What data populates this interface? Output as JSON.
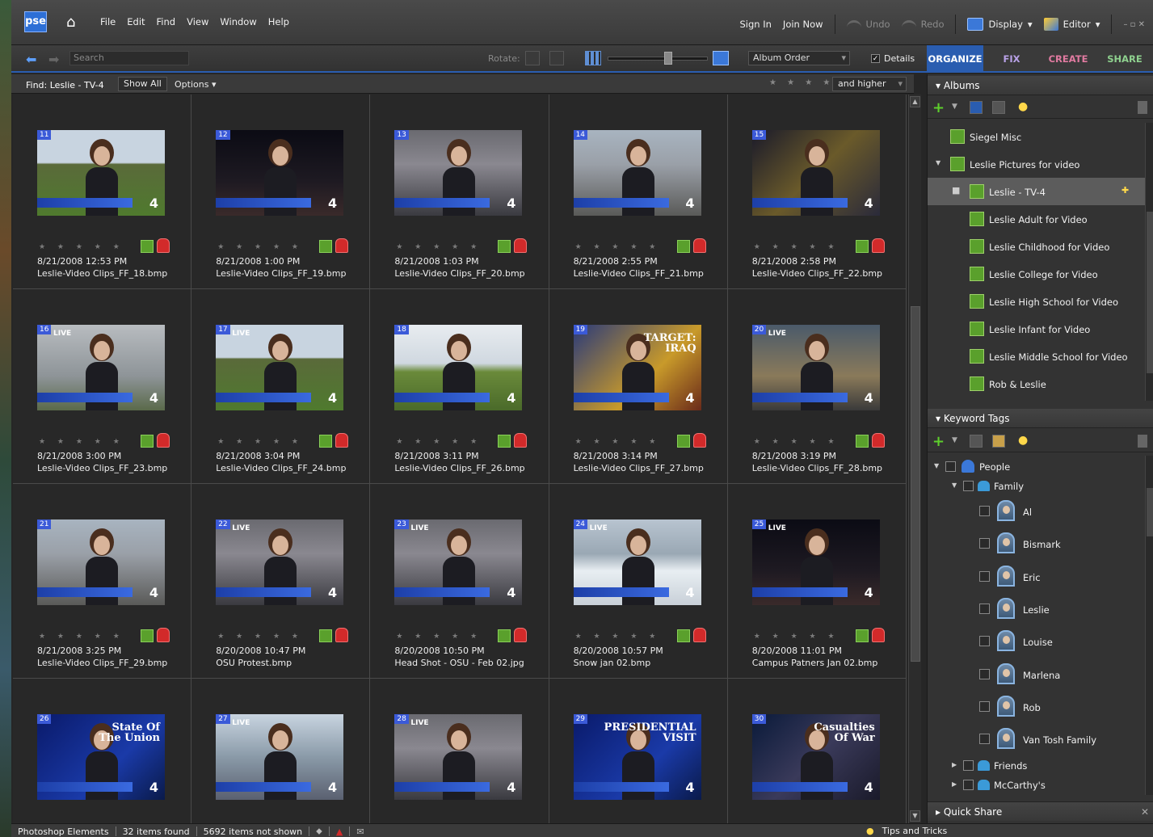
{
  "app": {
    "logo": "pse"
  },
  "menu": [
    "File",
    "Edit",
    "Find",
    "View",
    "Window",
    "Help"
  ],
  "menubar_right": {
    "sign_in": "Sign In",
    "join_now": "Join Now",
    "undo": "Undo",
    "redo": "Redo",
    "display": "Display",
    "editor": "Editor"
  },
  "toolbar": {
    "search_placeholder": "Search",
    "rotate_label": "Rotate:",
    "sort": "Album Order",
    "details_label": "Details",
    "details_checked": true
  },
  "tabs": [
    "ORGANIZE",
    "FIX",
    "CREATE",
    "SHARE"
  ],
  "findbar": {
    "find_label": "Find: Leslie - TV-4",
    "show_all": "Show All",
    "options": "Options",
    "rating_stars": "★ ★ ★ ★ ★",
    "rating_filter": "and higher"
  },
  "items": [
    {
      "num": "11",
      "date": "8/21/2008 12:53 PM",
      "name": "Leslie-Video Clips_FF_18.bmp",
      "scene": "outdoor",
      "live": ""
    },
    {
      "num": "12",
      "date": "8/21/2008 1:00 PM",
      "name": "Leslie-Video Clips_FF_19.bmp",
      "scene": "night",
      "live": ""
    },
    {
      "num": "13",
      "date": "8/21/2008 1:03 PM",
      "name": "Leslie-Video Clips_FF_20.bmp",
      "scene": "building",
      "live": ""
    },
    {
      "num": "14",
      "date": "8/21/2008 2:55 PM",
      "name": "Leslie-Video Clips_FF_21.bmp",
      "scene": "street",
      "live": ""
    },
    {
      "num": "15",
      "date": "8/21/2008 2:58 PM",
      "name": "Leslie-Video Clips_FF_22.bmp",
      "scene": "studio",
      "live": ""
    },
    {
      "num": "16",
      "date": "8/21/2008 3:00 PM",
      "name": "Leslie-Video Clips_FF_23.bmp",
      "scene": "fog",
      "live": "LIVE"
    },
    {
      "num": "17",
      "date": "8/21/2008 3:04 PM",
      "name": "Leslie-Video Clips_FF_24.bmp",
      "scene": "outdoor",
      "live": "LIVE"
    },
    {
      "num": "18",
      "date": "8/21/2008 3:11 PM",
      "name": "Leslie-Video Clips_FF_26.bmp",
      "scene": "sign",
      "live": ""
    },
    {
      "num": "19",
      "date": "8/21/2008 3:14 PM",
      "name": "Leslie-Video Clips_FF_27.bmp",
      "scene": "iraq",
      "live": "",
      "headline": "TARGET:\nIRAQ"
    },
    {
      "num": "20",
      "date": "8/21/2008 3:19 PM",
      "name": "Leslie-Video Clips_FF_28.bmp",
      "scene": "newsroom",
      "live": "LIVE"
    },
    {
      "num": "21",
      "date": "8/21/2008 3:25 PM",
      "name": "Leslie-Video Clips_FF_29.bmp",
      "scene": "street",
      "live": ""
    },
    {
      "num": "22",
      "date": "8/20/2008 10:47 PM",
      "name": "OSU Protest.bmp",
      "scene": "building",
      "live": "LIVE"
    },
    {
      "num": "23",
      "date": "8/20/2008 10:50 PM",
      "name": "Head Shot - OSU - Feb 02.jpg",
      "scene": "building",
      "live": "LIVE"
    },
    {
      "num": "24",
      "date": "8/20/2008 10:57 PM",
      "name": "Snow jan 02.bmp",
      "scene": "snow",
      "live": "LIVE"
    },
    {
      "num": "25",
      "date": "8/20/2008 11:01 PM",
      "name": "Campus Patners Jan 02.bmp",
      "scene": "night",
      "live": "LIVE"
    },
    {
      "num": "26",
      "date": "",
      "name": "",
      "scene": "stateunion",
      "live": "",
      "headline": "State Of\nThe Union"
    },
    {
      "num": "27",
      "date": "",
      "name": "",
      "scene": "umbrella",
      "live": "LIVE"
    },
    {
      "num": "28",
      "date": "",
      "name": "",
      "scene": "building",
      "live": "LIVE"
    },
    {
      "num": "29",
      "date": "",
      "name": "",
      "scene": "stateunion",
      "live": "",
      "headline": "PRESIDENTIAL\nVISIT"
    },
    {
      "num": "30",
      "date": "",
      "name": "",
      "scene": "war",
      "live": "",
      "headline": "Casualties\nOf War"
    }
  ],
  "albums": {
    "title": "Albums",
    "rows": [
      {
        "label": "Siegel Misc",
        "indent": 0,
        "expand": false,
        "selected": false
      },
      {
        "label": "Leslie Pictures for video",
        "indent": 0,
        "expand": true,
        "selected": false
      },
      {
        "label": "Leslie - TV-4",
        "indent": 1,
        "expand": false,
        "selected": true
      },
      {
        "label": "Leslie Adult for Video",
        "indent": 1,
        "expand": false,
        "selected": false
      },
      {
        "label": "Leslie Childhood for Video",
        "indent": 1,
        "expand": false,
        "selected": false
      },
      {
        "label": "Leslie College for Video",
        "indent": 1,
        "expand": false,
        "selected": false
      },
      {
        "label": "Leslie High School for Video",
        "indent": 1,
        "expand": false,
        "selected": false
      },
      {
        "label": "Leslie Infant for Video",
        "indent": 1,
        "expand": false,
        "selected": false
      },
      {
        "label": "Leslie Middle School for Video",
        "indent": 1,
        "expand": false,
        "selected": false
      },
      {
        "label": "Rob & Leslie",
        "indent": 1,
        "expand": false,
        "selected": false
      }
    ]
  },
  "keywords": {
    "title": "Keyword Tags",
    "people": "People",
    "family": "Family",
    "persons": [
      "Al",
      "Bismark",
      "Eric",
      "Leslie",
      "Louise",
      "Marlena",
      "Rob",
      "Van Tosh Family"
    ],
    "friends": "Friends",
    "mccarthys": "McCarthy's"
  },
  "quick_share": {
    "title": "Quick Share",
    "close": "✕"
  },
  "status": {
    "app": "Photoshop Elements",
    "found": "32 items found",
    "not_shown": "5692 items not shown",
    "tips": "Tips and Tricks"
  },
  "colors": {
    "accent": "#2a5db0",
    "tag_green": "#5aa02c",
    "lock_red": "#d22a2a"
  }
}
